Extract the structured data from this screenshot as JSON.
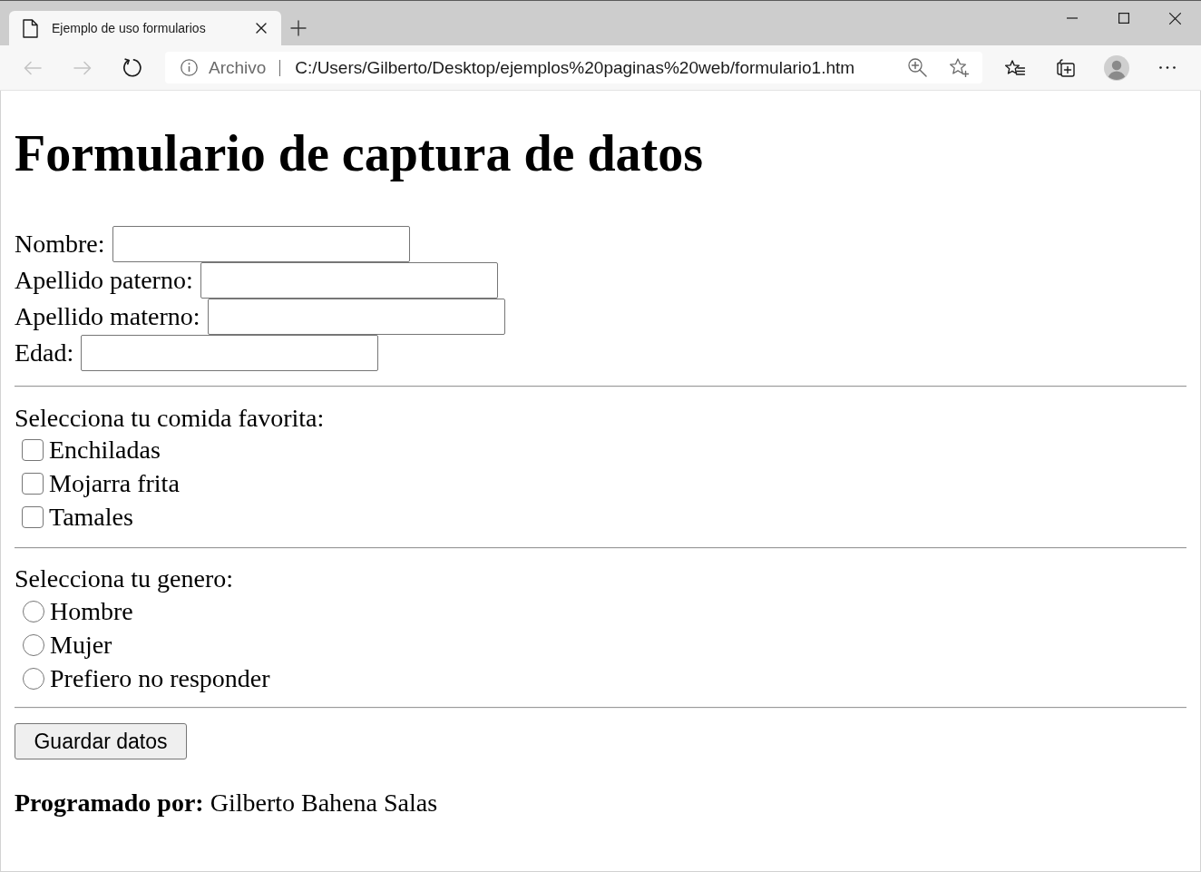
{
  "browser": {
    "tabs": [
      {
        "title": "Ejemplo de uso formularios",
        "selected": true
      }
    ],
    "navigation": [
      {
        "kind": "back",
        "disabled": true
      },
      {
        "kind": "forward",
        "disabled": true
      },
      {
        "kind": "reload",
        "disabled": false
      }
    ],
    "address_bar": {
      "security_label": "Archivo",
      "url": "C:/Users/Gilberto/Desktop/ejemplos%20paginas%20web/formulario1.htm"
    }
  },
  "page": {
    "heading": "Formulario de captura de datos",
    "fields": [
      {
        "label": "Nombre:"
      },
      {
        "label": "Apellido paterno:"
      },
      {
        "label": "Apellido materno:"
      },
      {
        "label": "Edad:"
      }
    ],
    "food": {
      "prompt": "Selecciona tu comida favorita:",
      "options": [
        {
          "label": "Enchiladas",
          "checked": false
        },
        {
          "label": "Mojarra frita",
          "checked": false
        },
        {
          "label": "Tamales",
          "checked": false
        }
      ]
    },
    "gender": {
      "prompt": "Selecciona tu genero:",
      "options": [
        {
          "label": "Hombre",
          "selected": false
        },
        {
          "label": "Mujer",
          "selected": false
        },
        {
          "label": "Prefiero no responder",
          "selected": false
        }
      ]
    },
    "submit_button": "Guardar datos",
    "credit": "**Programado por:** Gilberto Bahena Salas"
  }
}
